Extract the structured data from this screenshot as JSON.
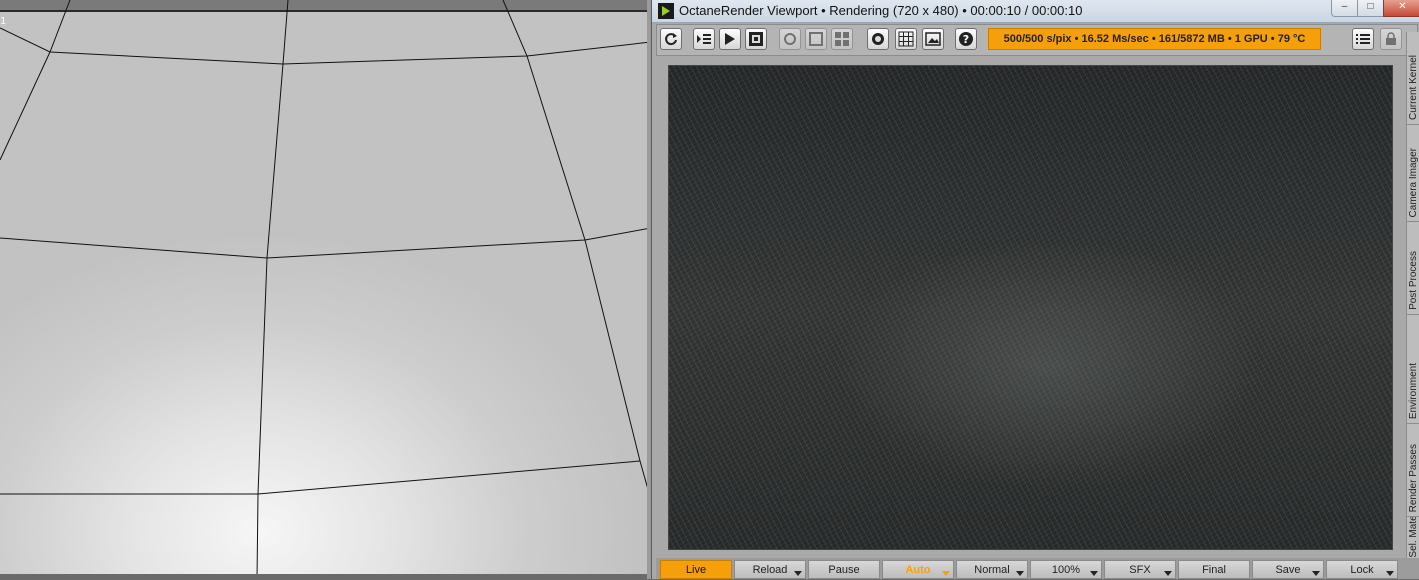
{
  "viewport3d": {
    "label": "1"
  },
  "octane": {
    "title": "OctaneRender Viewport • Rendering (720 x 480) • 00:00:10 / 00:00:10",
    "window_buttons": {
      "minimize": "–",
      "maximize": "□",
      "close": "✕"
    },
    "toolbar": {
      "buttons": [
        "refresh-icon",
        "list-arrow-icon",
        "play-icon",
        "fit-icon",
        "focus-icon",
        "region-icon",
        "grid-cells-icon",
        "circle-icon",
        "grid-icon",
        "image-icon",
        "help-icon",
        "menu-list-icon",
        "lock-small-icon"
      ],
      "status": "500/500 s/pix • 16.52 Ms/sec • 161/5872 MB • 1 GPU • 79 °C"
    },
    "side_tabs": [
      "Current Kernel",
      "Camera Imager",
      "Post Process",
      "Environment",
      "Render Passes",
      "Sel. Material"
    ],
    "bottom_buttons": {
      "live": "Live",
      "reload": "Reload",
      "pause": "Pause",
      "auto": "Auto",
      "normal": "Normal",
      "zoom": "100%",
      "sfx": "SFX",
      "final": "Final",
      "save": "Save",
      "lock": "Lock"
    },
    "colors": {
      "accent": "#f5a00b",
      "panel": "#a9a9a9"
    }
  }
}
